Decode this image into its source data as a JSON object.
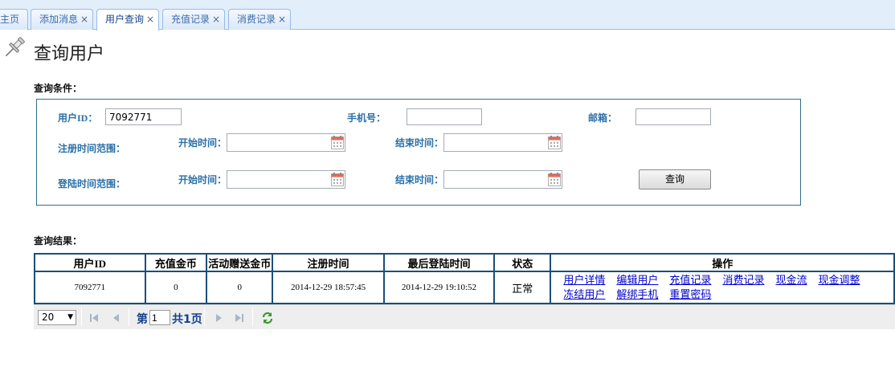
{
  "tabs": [
    {
      "label": "主页",
      "closable": false,
      "active": false
    },
    {
      "label": "添加消息",
      "closable": true,
      "active": false
    },
    {
      "label": "用户查询",
      "closable": true,
      "active": true
    },
    {
      "label": "充值记录",
      "closable": true,
      "active": false
    },
    {
      "label": "消费记录",
      "closable": true,
      "active": false
    }
  ],
  "tab_close_glyph": "×",
  "page_title": "查询用户",
  "query": {
    "section_label": "查询条件：",
    "user_id_label": "用户ID：",
    "user_id_value": "7092771",
    "phone_label": "手机号：",
    "phone_value": "",
    "email_label": "邮箱：",
    "email_value": "",
    "register_range_label": "注册时间范围：",
    "login_range_label": "登陆时间范围：",
    "start_label": "开始时间：",
    "end_label": "结束时间：",
    "register_start": "",
    "register_end": "",
    "login_start": "",
    "login_end": "",
    "submit_label": "查询"
  },
  "results": {
    "section_label": "查询结果：",
    "columns": [
      "用户ID",
      "充值金币",
      "活动赠送金币",
      "注册时间",
      "最后登陆时间",
      "状态",
      "操作"
    ],
    "rows": [
      {
        "user_id": "7092771",
        "recharge_coins": "0",
        "bonus_coins": "0",
        "register_time": "2014-12-29 18:57:45",
        "last_login": "2014-12-29 19:10:52",
        "status": "正常",
        "actions_line1": [
          "用户详情",
          "编辑用户",
          "充值记录",
          "消费记录",
          "现金流",
          "现金调整"
        ],
        "actions_line2": [
          "冻结用户",
          "解绑手机",
          "重置密码"
        ]
      }
    ]
  },
  "pager": {
    "page_size": "20",
    "page_prefix": "第",
    "page_value": "1",
    "total_text": "共1页"
  },
  "icons": {
    "pin": "pin-icon",
    "calendar": "calendar-icon",
    "first": "first-page-icon",
    "prev": "prev-page-icon",
    "next": "next-page-icon",
    "last": "last-page-icon",
    "refresh": "refresh-icon"
  },
  "colors": {
    "tab_bar": "#e3eefb",
    "tab_text": "#3a6cae",
    "form_label": "#2a70a8",
    "table_border": "#1a4f79",
    "link": "#0000cc",
    "refresh_green": "#3a9a2a"
  }
}
